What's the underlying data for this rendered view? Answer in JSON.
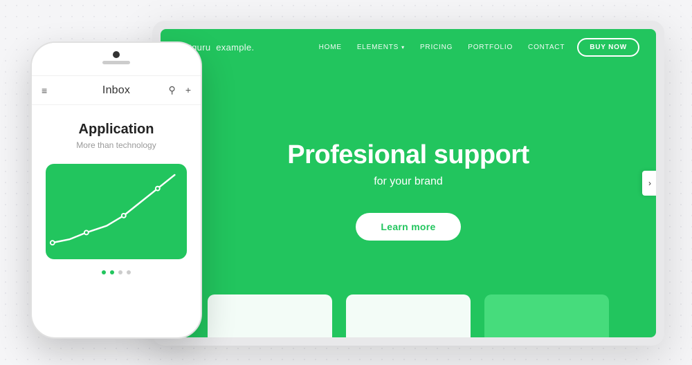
{
  "background": {
    "color": "#f5f5f7"
  },
  "laptop": {
    "logo": "Netguru",
    "logo_suffix": "example.",
    "nav": {
      "links": [
        {
          "label": "HOME"
        },
        {
          "label": "ELEMENTS",
          "has_caret": true
        },
        {
          "label": "PRICING"
        },
        {
          "label": "PORTFOLIO"
        },
        {
          "label": "CONTACT"
        }
      ],
      "cta_label": "BUY NOW"
    },
    "hero": {
      "title": "Profesional support",
      "subtitle": "for your brand",
      "cta_label": "Learn more"
    },
    "chevron": "›"
  },
  "phone": {
    "inbox_title": "Inbox",
    "menu_icon": "≡",
    "search_icon": "🔍",
    "add_icon": "+",
    "app_title": "Application",
    "app_subtitle": "More than technology",
    "dots": [
      {
        "active": true
      },
      {
        "active": true
      },
      {
        "active": false
      },
      {
        "active": false
      }
    ]
  }
}
